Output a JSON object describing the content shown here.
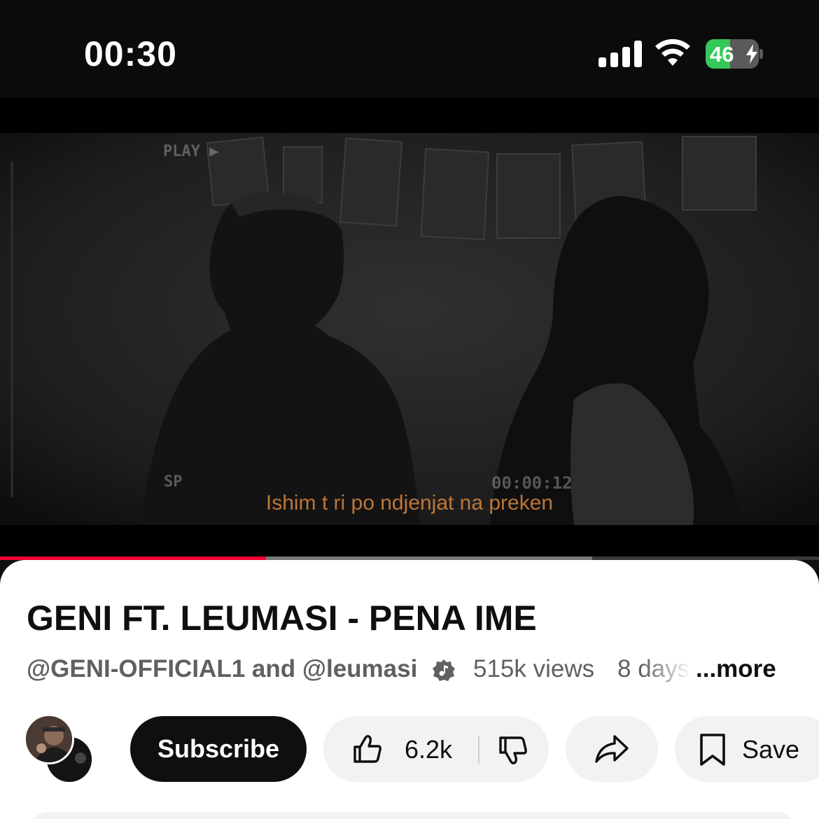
{
  "status_bar": {
    "time": "00:30",
    "battery_percent": "46",
    "battery_color": "#34c759",
    "icons": [
      "cellular-signal-icon",
      "wifi-icon",
      "battery-charging-icon"
    ]
  },
  "video": {
    "overlay_play": "PLAY",
    "overlay_sp": "SP",
    "overlay_timecode": "00:00:12",
    "subtitle": "Ishim t ri po ndjenjat na preken",
    "progress_played": 0.325,
    "progress_buffered": 0.723,
    "progress_color": "#ff0033"
  },
  "details": {
    "title": "GENI FT. LEUMASI - PENA IME",
    "channels": "@GENI-OFFICIAL1 and @leumasi",
    "views": "515k views",
    "age": "8 days",
    "more": "...more"
  },
  "actions": {
    "subscribe": "Subscribe",
    "like_count": "6.2k",
    "save": "Save"
  }
}
